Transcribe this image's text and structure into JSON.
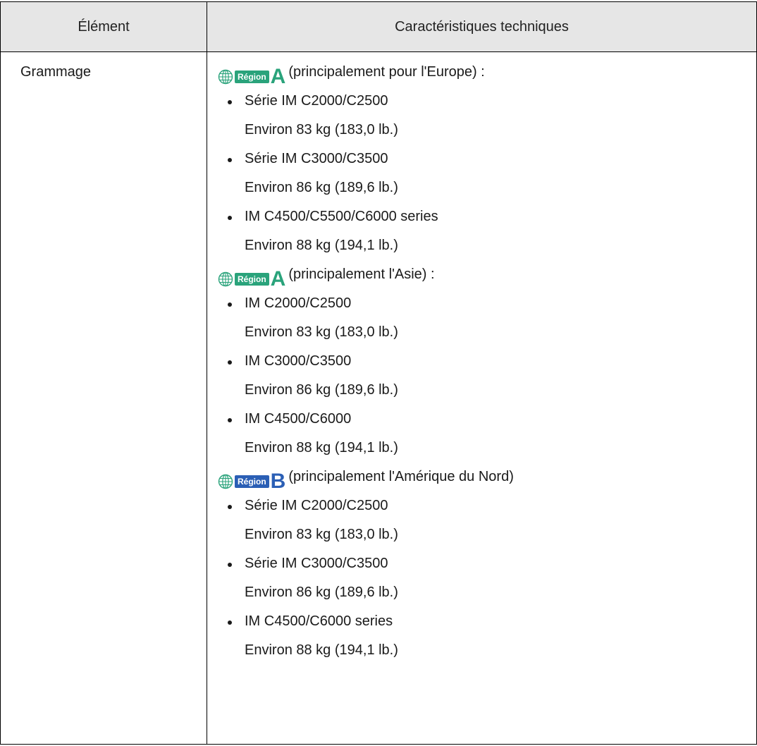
{
  "table": {
    "header": {
      "element": "Élément",
      "specs": "Caractéristiques techniques"
    },
    "row": {
      "label": "Grammage",
      "lines": [
        {
          "kind": "region",
          "chip": "Région",
          "letter": "A",
          "color": "#2aa37b",
          "text": "(principalement pour l'Europe) :"
        },
        {
          "kind": "bullet",
          "text": "Série IM C2000/C2500"
        },
        {
          "kind": "detail",
          "text": "Environ 83 kg (183,0 lb.)"
        },
        {
          "kind": "bullet",
          "text": "Série IM C3000/C3500"
        },
        {
          "kind": "detail",
          "text": "Environ 86 kg (189,6 lb.)"
        },
        {
          "kind": "bullet",
          "text": "IM C4500/C5500/C6000 series"
        },
        {
          "kind": "detail",
          "text": "Environ 88 kg (194,1 lb.)"
        },
        {
          "kind": "region",
          "chip": "Région",
          "letter": "A",
          "color": "#2aa37b",
          "text": "(principalement l'Asie) :"
        },
        {
          "kind": "bullet",
          "text": "IM C2000/C2500"
        },
        {
          "kind": "detail",
          "text": "Environ 83 kg (183,0 lb.)"
        },
        {
          "kind": "bullet",
          "text": "IM C3000/C3500"
        },
        {
          "kind": "detail",
          "text": "Environ 86 kg (189,6 lb.)"
        },
        {
          "kind": "bullet",
          "text": "IM C4500/C6000"
        },
        {
          "kind": "detail",
          "text": "Environ 88 kg (194,1 lb.)"
        },
        {
          "kind": "region",
          "chip": "Région",
          "letter": "B",
          "color": "#2b5fb5",
          "text": "(principalement l'Amérique du Nord)"
        },
        {
          "kind": "bullet",
          "text": "Série IM C2000/C2500"
        },
        {
          "kind": "detail",
          "text": "Environ 83 kg (183,0 lb.)"
        },
        {
          "kind": "bullet",
          "text": "Série IM C3000/C3500"
        },
        {
          "kind": "detail",
          "text": "Environ 86 kg (189,6 lb.)"
        },
        {
          "kind": "bullet",
          "text": "IM C4500/C6000 series"
        },
        {
          "kind": "detail",
          "text": "Environ 88 kg (194,1 lb.)"
        }
      ]
    }
  },
  "colors": {
    "header_bg": "#e6e6e6",
    "region_a": "#2aa37b",
    "region_b": "#2b5fb5",
    "globe": "#2aa37b"
  },
  "icons": {
    "region": "globe-icon"
  }
}
